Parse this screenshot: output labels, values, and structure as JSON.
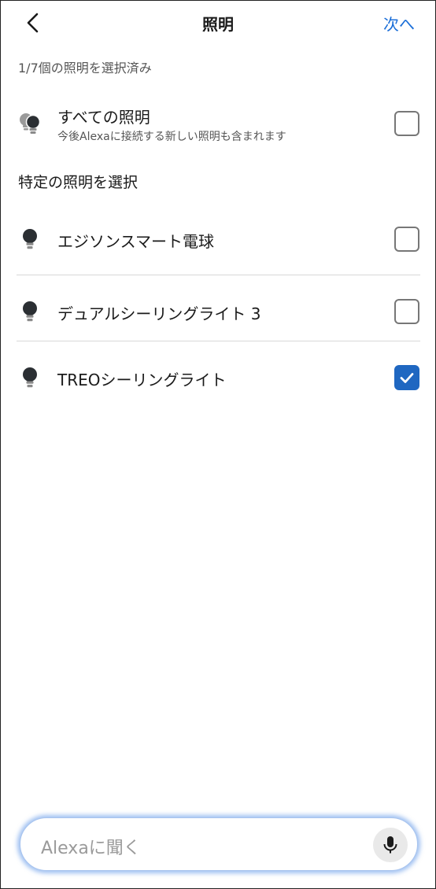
{
  "header": {
    "title": "照明",
    "next_label": "次へ"
  },
  "selection_count": "1/7個の照明を選択済み",
  "all_lights": {
    "label": "すべての照明",
    "description": "今後Alexaに接続する新しい照明も含まれます",
    "checked": false
  },
  "section_title": "特定の照明を選択",
  "lights": [
    {
      "label": "エジソンスマート電球",
      "checked": false
    },
    {
      "label": "デュアルシーリングライト 3",
      "checked": false
    },
    {
      "label": "TREOシーリングライト",
      "checked": true
    }
  ],
  "ask_bar": {
    "placeholder": "Alexaに聞く"
  },
  "colors": {
    "accent": "#1a6ed8",
    "checkbox_checked": "#1f67c1"
  }
}
